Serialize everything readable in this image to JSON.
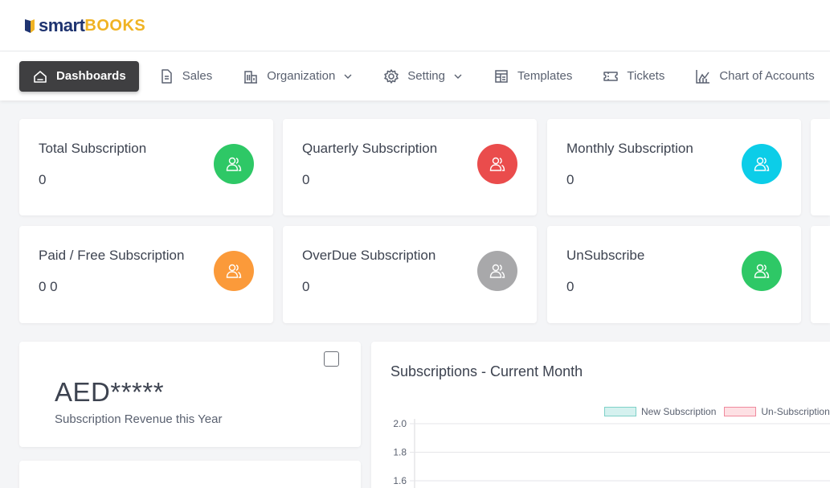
{
  "brand": {
    "smart": "smart",
    "books": "BOOKS"
  },
  "nav": [
    {
      "label": "Dashboards",
      "icon": "home-icon",
      "active": true
    },
    {
      "label": "Sales",
      "icon": "document-icon"
    },
    {
      "label": "Organization",
      "icon": "building-icon",
      "dropdown": true
    },
    {
      "label": "Setting",
      "icon": "gear-icon",
      "dropdown": true
    },
    {
      "label": "Templates",
      "icon": "template-icon"
    },
    {
      "label": "Tickets",
      "icon": "ticket-icon"
    },
    {
      "label": "Chart of Accounts",
      "icon": "chart-icon"
    }
  ],
  "stats": [
    {
      "title": "Total Subscription",
      "value": "0",
      "color": "#2ec866"
    },
    {
      "title": "Quarterly Subscription",
      "value": "0",
      "color": "#ea4c4c"
    },
    {
      "title": "Monthly Subscription",
      "value": "0",
      "color": "#0ccde8"
    },
    {
      "title": "Paid / Free Subscription",
      "value": "0 0",
      "color": "#fb9a3a"
    },
    {
      "title": "OverDue Subscription",
      "value": "0",
      "color": "#a8a8aa"
    },
    {
      "title": "UnSubscribe",
      "value": "0",
      "color": "#2ec866"
    }
  ],
  "revenue": {
    "value": "AED*****",
    "label": "Subscription Revenue this Year"
  },
  "chart": {
    "title": "Subscriptions - Current Month",
    "legend": [
      {
        "name": "New Subscription",
        "fill": "#d5f1ef",
        "stroke": "#7fd1c8"
      },
      {
        "name": "Un-Subscription",
        "fill": "#fde0e4",
        "stroke": "#f08a9e"
      }
    ]
  },
  "chart_data": {
    "type": "bar",
    "title": "Subscriptions - Current Month",
    "series": [
      {
        "name": "New Subscription",
        "values": []
      },
      {
        "name": "Un-Subscription",
        "values": []
      }
    ],
    "yticks": [
      "2.0",
      "1.8",
      "1.6"
    ],
    "grid": true,
    "legend_position": "top-right"
  }
}
